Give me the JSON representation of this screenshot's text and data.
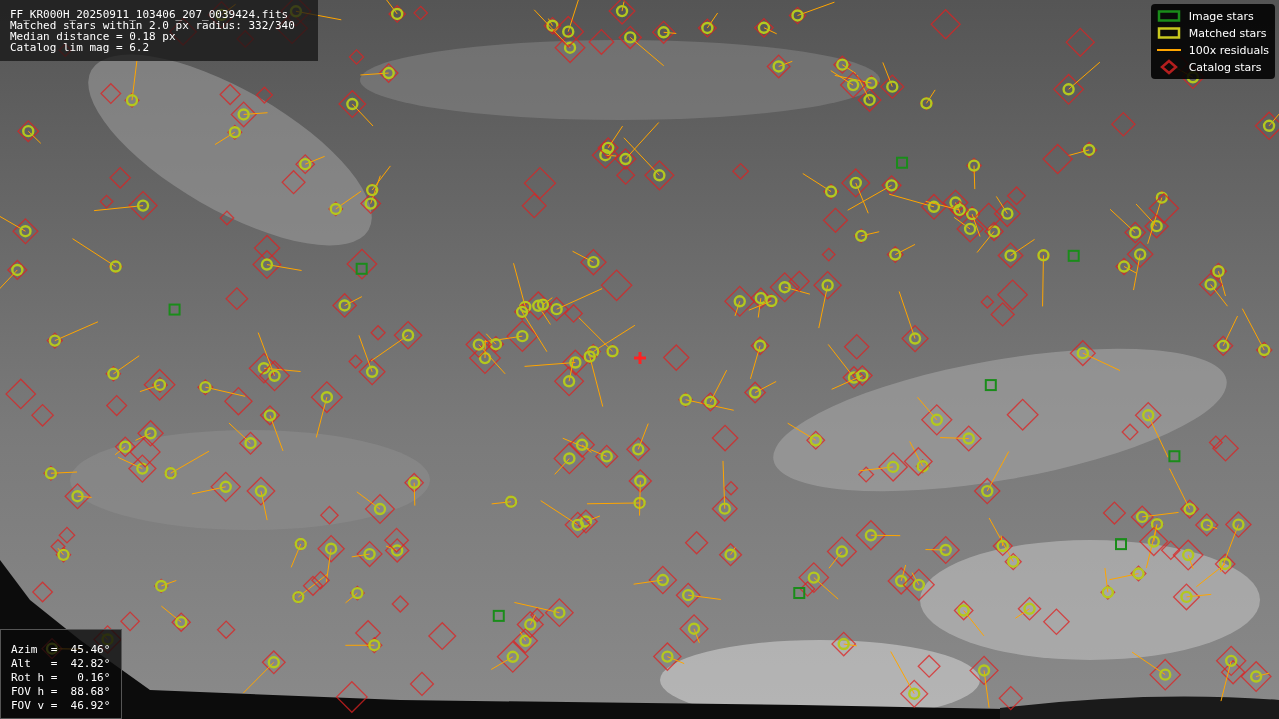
{
  "info_box": {
    "lines": [
      "FF_KR000H_20250911_103406_207_0039424.fits",
      "Matched stars within 2.0 px radius: 332/340",
      "Median distance = 0.18 px",
      "Catalog lim mag = 6.2"
    ]
  },
  "legend": {
    "items": [
      {
        "label": "Image stars",
        "kind": "box",
        "color": "#1a8c1a"
      },
      {
        "label": "Matched stars",
        "kind": "ring",
        "color": "#c8c81e"
      },
      {
        "label": "100x residuals",
        "kind": "line",
        "color": "#ffa500"
      },
      {
        "label": "Catalog stars",
        "kind": "diamond",
        "color": "#b41e1e"
      }
    ]
  },
  "pointing_box": {
    "lines": [
      "Azim  =  45.46°",
      "Alt   =  42.82°",
      "Rot h =   0.16°",
      "FOV h =  88.68°",
      "FOV v =  46.92°"
    ]
  }
}
